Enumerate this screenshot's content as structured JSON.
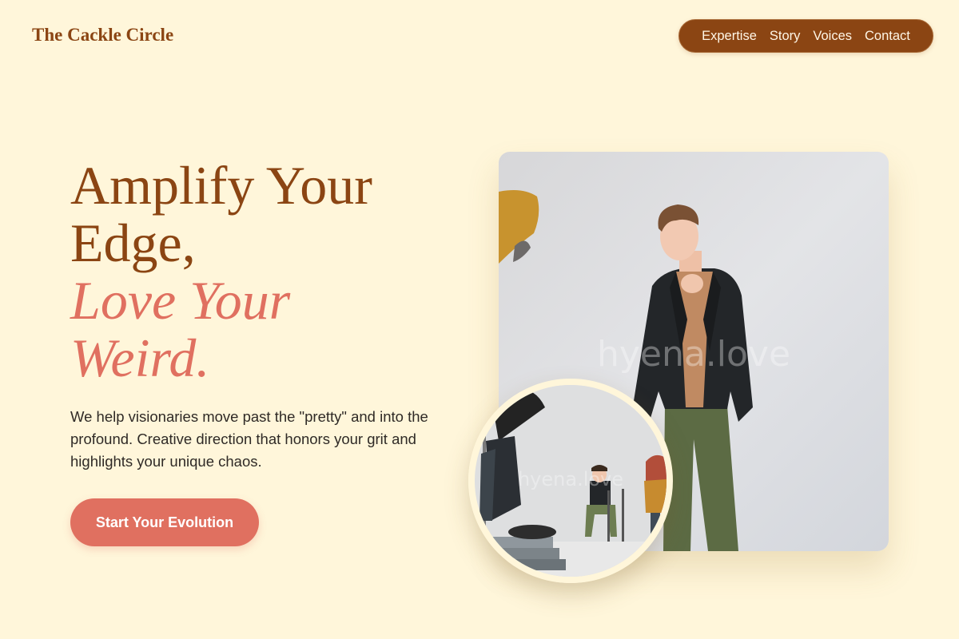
{
  "header": {
    "brand": "The Cackle Circle",
    "nav": [
      {
        "label": "Expertise"
      },
      {
        "label": "Story"
      },
      {
        "label": "Voices"
      },
      {
        "label": "Contact"
      }
    ]
  },
  "hero": {
    "headline_lines": [
      "Amplify Your",
      "Edge,"
    ],
    "accent_lines": [
      "Love Your",
      "Weird."
    ],
    "body": "We help visionaries move past the \"pretty\" and into the profound. Creative direction that honors your grit and highlights your unique chaos.",
    "cta_label": "Start Your Evolution"
  },
  "images": {
    "main_watermark": "hyena.love",
    "inset_watermark": "hyena.love"
  },
  "colors": {
    "background": "#fff6da",
    "brand_brown": "#8b4513",
    "accent_coral": "#e07060",
    "body_text": "#2f2a26"
  }
}
